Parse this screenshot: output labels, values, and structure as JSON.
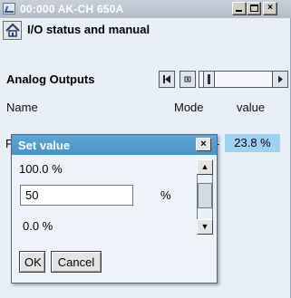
{
  "window": {
    "title": "00:000 AK-CH 650A",
    "minimize": "_",
    "maximize": "□",
    "close": "×"
  },
  "page": {
    "title": "I/O status and manual"
  },
  "section": {
    "title": "Analog Outputs"
  },
  "columns": {
    "name": "Name",
    "mode": "Mode",
    "value": "value"
  },
  "row": {
    "name": "Pu",
    "mode": "-",
    "value": "23.8 %"
  },
  "dialog": {
    "title": "Set value",
    "close": "×",
    "max": "100.0 %",
    "input_value": "50",
    "unit": "%",
    "min": "0.0 %",
    "ok": "OK",
    "cancel": "Cancel",
    "up_arrow": "▲",
    "down_arrow": "▼"
  }
}
